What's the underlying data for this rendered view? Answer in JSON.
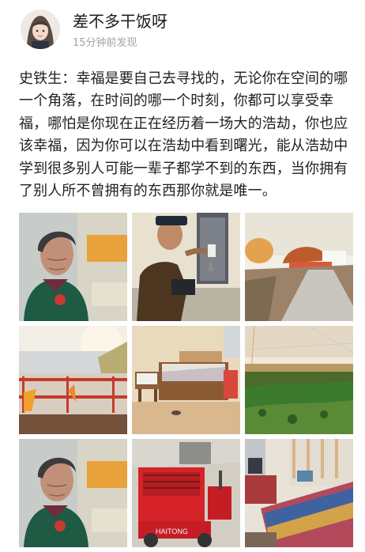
{
  "post": {
    "author_name": "差不多干饭呀",
    "time": "15分钟前发现",
    "text": "史铁生：幸福是要自己去寻找的，无论你在空间的哪一个角落，在时间的哪一个时刻，你都可以享受幸福，哪怕是你现在正在经历着一场大的浩劫，你也应该幸福，因为你可以在浩劫中看到曙光，能从浩劫中学到很多别人可能一辈子都学不到的东西，当你拥有了别人所不曾拥有的东西那你就是唯一。"
  },
  "photos": [
    {
      "subject": "elderly-woman-portrait"
    },
    {
      "subject": "elderly-man-seated"
    },
    {
      "subject": "village-road"
    },
    {
      "subject": "balcony-sunrise"
    },
    {
      "subject": "bedroom-interior"
    },
    {
      "subject": "vegetable-field"
    },
    {
      "subject": "elderly-woman-portrait"
    },
    {
      "subject": "red-tricycle"
    },
    {
      "subject": "bed-quilt"
    }
  ],
  "tricycle_brand": "HAITONG"
}
